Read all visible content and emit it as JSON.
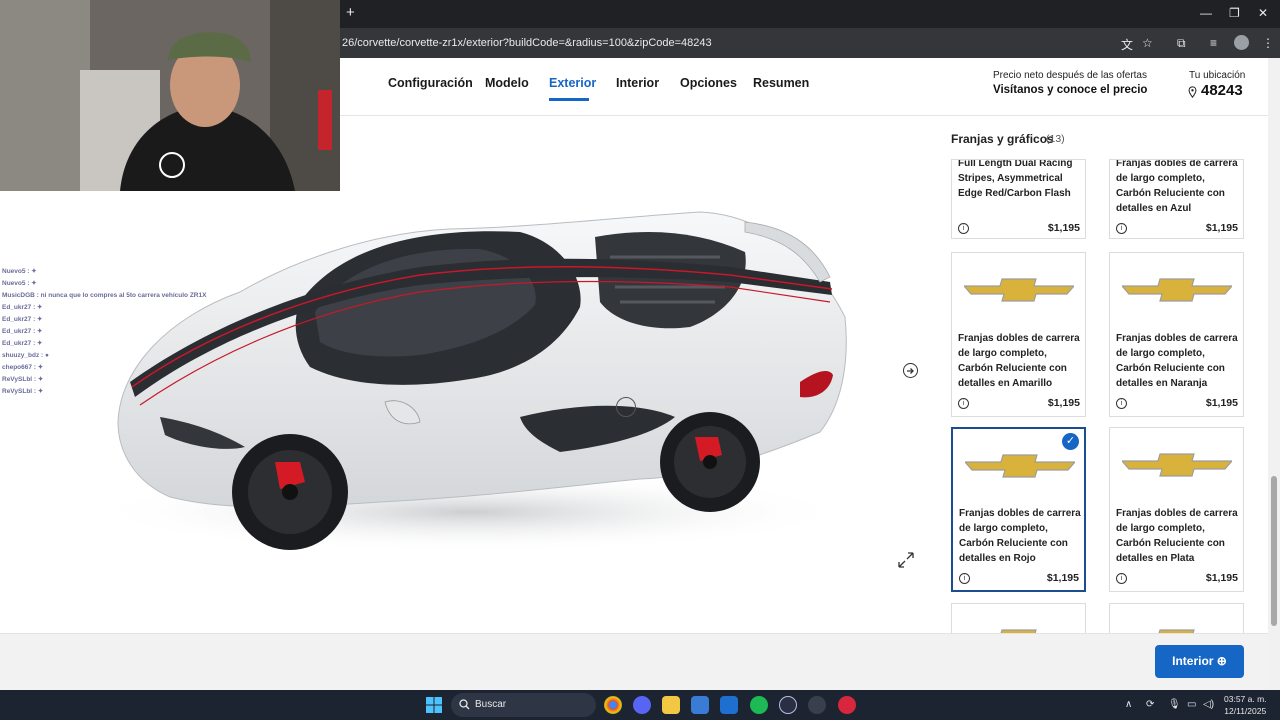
{
  "browser": {
    "new_tab": "+",
    "url": "26/corvette/corvette-zr1x/exterior?buildCode=&radius=100&zipCode=48243",
    "min": "—",
    "restore": "❐",
    "close": "✕",
    "translate": "文",
    "star": "☆",
    "ext": "⧉",
    "menu": "⋮"
  },
  "nav": {
    "items": [
      "Configuración",
      "Modelo",
      "Exterior",
      "Interior",
      "Opciones",
      "Resumen"
    ],
    "active": "Exterior"
  },
  "price": {
    "label": "Precio neto después de las ofertas",
    "cta": "Visítanos y conoce el precio"
  },
  "location": {
    "label": "Tu ubicación",
    "zip": "48243"
  },
  "chat": {
    "lines": [
      "Nuevo5 : ✦",
      "Nuevo5 : ✦",
      "MusicDGB : ni nunca que lo compres al 5to carrera vehículo ZR1X",
      "Ed_ukr27 : ✦",
      "Ed_ukr27 : ✦",
      "Ed_ukr27 : ✦",
      "Ed_ukr27 : ✦",
      "shuuzy_bdz : ●",
      "chepo667 : ✦",
      "ReVySLbl : ✦",
      "ReVySLbl : ✦"
    ]
  },
  "panel": {
    "title": "Franjas y gráficos",
    "count": "(13)",
    "cards": [
      {
        "text": "Full Length Dual Racing Stripes, Asymmetrical Edge Red/Carbon Flash",
        "price": "$1,195",
        "selected": false
      },
      {
        "text": "Franjas dobles de carrera de largo completo, Carbón Reluciente con detalles en Azul",
        "price": "$1,195",
        "selected": false
      },
      {
        "text": "Franjas dobles de carrera de largo completo, Carbón Reluciente con detalles en Amarillo",
        "price": "$1,195",
        "selected": false
      },
      {
        "text": "Franjas dobles de carrera de largo completo, Carbón Reluciente con detalles en Naranja",
        "price": "$1,195",
        "selected": false
      },
      {
        "text": "Franjas dobles de carrera de largo completo, Carbón Reluciente con detalles en Rojo",
        "price": "$1,195",
        "selected": true
      },
      {
        "text": "Franjas dobles de carrera de largo completo, Carbón Reluciente con detalles en Plata",
        "price": "$1,195",
        "selected": false
      }
    ],
    "info_icon": "i",
    "check": "✓"
  },
  "bottom": {
    "next_label": "Interior ⊕"
  },
  "taskbar": {
    "search": "Buscar",
    "time": "03:57 a. m.",
    "date": "12/11/2025"
  },
  "colors": {
    "accent": "#1666c5",
    "selected_border": "#1a4e8f",
    "car_body": "#eceef0",
    "stripe": "#2a2d31",
    "stripe_edge": "#c8182a",
    "logo_gold": "#d9b23c"
  }
}
